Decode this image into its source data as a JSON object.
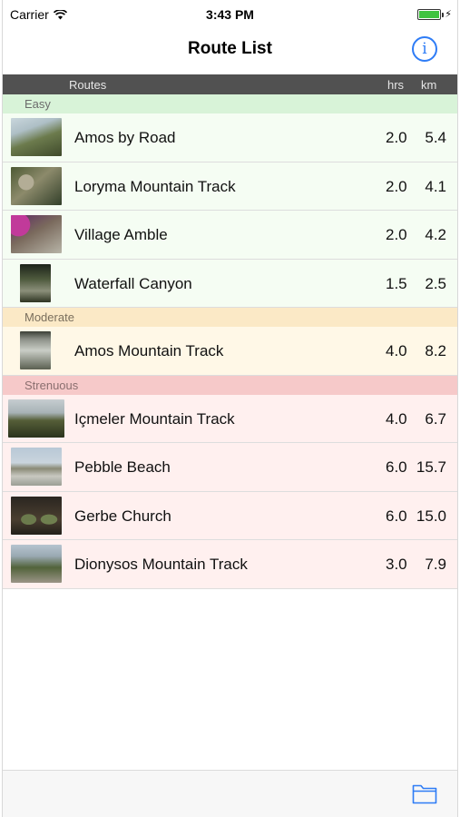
{
  "status_bar": {
    "carrier": "Carrier",
    "time": "3:43 PM",
    "battery_color": "#3fc33f"
  },
  "nav": {
    "title": "Route List",
    "info_icon": "info-icon",
    "info_glyph": "i",
    "accent_color": "#2e7cf6"
  },
  "columns": {
    "routes": "Routes",
    "hrs": "hrs",
    "km": "km"
  },
  "sections": [
    {
      "title": "Easy",
      "color": "#d8f3d8",
      "routes": [
        {
          "name": "Amos by Road",
          "hrs": "2.0",
          "km": "5.4"
        },
        {
          "name": "Loryma Mountain Track",
          "hrs": "2.0",
          "km": "4.1"
        },
        {
          "name": "Village Amble",
          "hrs": "2.0",
          "km": "4.2"
        },
        {
          "name": "Waterfall Canyon",
          "hrs": "1.5",
          "km": "2.5"
        }
      ]
    },
    {
      "title": "Moderate",
      "color": "#fbe9c6",
      "routes": [
        {
          "name": "Amos Mountain Track",
          "hrs": "4.0",
          "km": "8.2"
        }
      ]
    },
    {
      "title": "Strenuous",
      "color": "#f6c9c9",
      "routes": [
        {
          "name": "Içmeler Mountain Track",
          "hrs": "4.0",
          "km": "6.7"
        },
        {
          "name": "Pebble Beach",
          "hrs": "6.0",
          "km": "15.7"
        },
        {
          "name": "Gerbe Church",
          "hrs": "6.0",
          "km": "15.0"
        },
        {
          "name": "Dionysos Mountain Track",
          "hrs": "3.0",
          "km": "7.9"
        }
      ]
    }
  ],
  "toolbar": {
    "folder_icon": "folder-icon"
  }
}
